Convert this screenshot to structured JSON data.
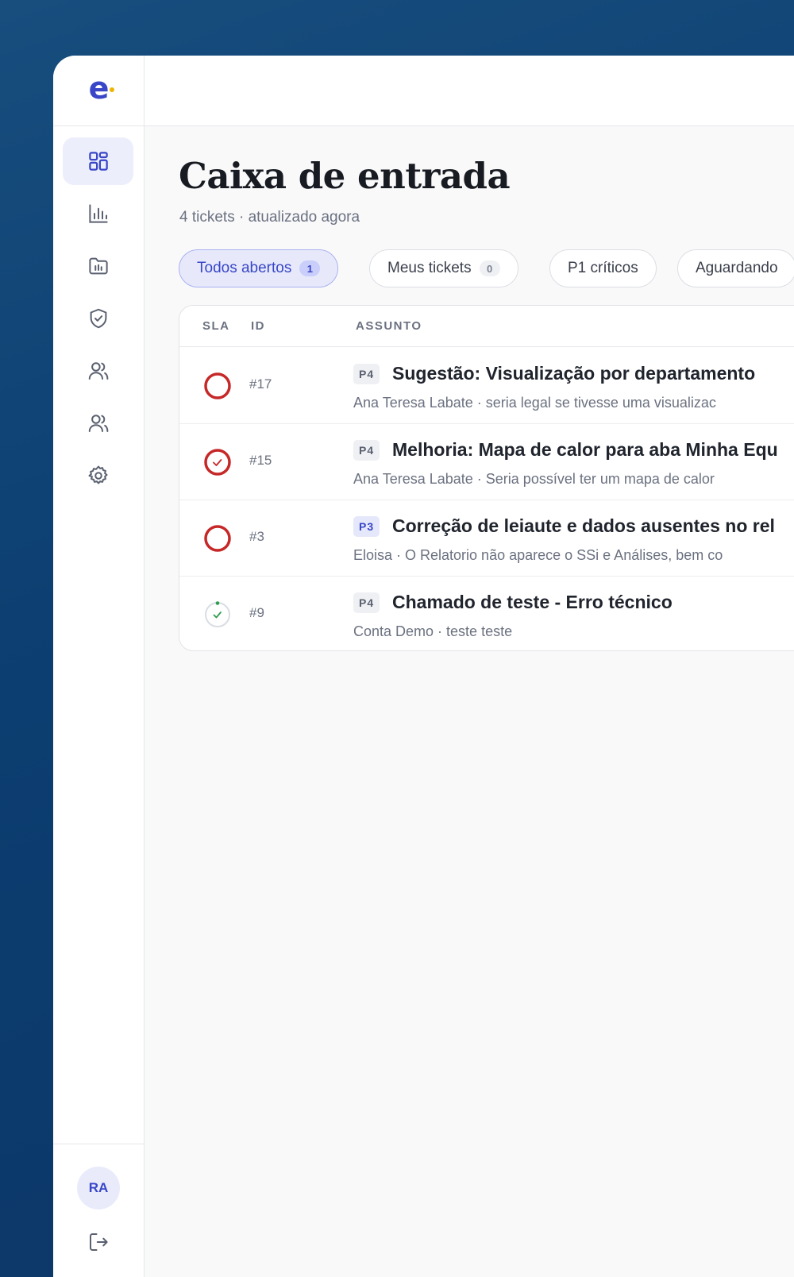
{
  "colors": {
    "brand": "#3846c7",
    "sla_breached": "#c62828",
    "sla_ok": "#2e9e4f",
    "background_gradient": "#0d3f72"
  },
  "sidebar": {
    "logo": "e",
    "nav": [
      {
        "icon": "dashboard-icon",
        "active": true
      },
      {
        "icon": "bar-chart-icon",
        "active": false
      },
      {
        "icon": "folder-chart-icon",
        "active": false
      },
      {
        "icon": "shield-check-icon",
        "active": false
      },
      {
        "icon": "users-icon",
        "active": false
      },
      {
        "icon": "team-icon",
        "active": false
      },
      {
        "icon": "gear-icon",
        "active": false
      }
    ],
    "user_initials": "RA",
    "logout_icon": "logout-icon"
  },
  "page": {
    "title": "Caixa de entrada",
    "subtitle": "4 tickets · atualizado agora"
  },
  "filters": [
    {
      "label": "Todos abertos",
      "count": "1",
      "active": true
    },
    {
      "label": "Meus tickets",
      "count": "0",
      "active": false
    },
    {
      "label": "P1 críticos",
      "count": null,
      "active": false
    },
    {
      "label": "Aguardando",
      "count": null,
      "active": false
    }
  ],
  "table": {
    "columns": {
      "sla": "SLA",
      "id": "ID",
      "subject": "ASSUNTO"
    },
    "rows": [
      {
        "sla_state": "empty",
        "id": "#17",
        "priority": "P4",
        "subject": "Sugestão: Visualização por departamento",
        "preview": "Ana Teresa Labate · seria legal se tivesse uma visualizac"
      },
      {
        "sla_state": "breached-check",
        "id": "#15",
        "priority": "P4",
        "subject": "Melhoria: Mapa de calor para aba Minha Equ",
        "preview": "Ana Teresa Labate · Seria possível ter um mapa de calor"
      },
      {
        "sla_state": "empty",
        "id": "#3",
        "priority": "P3",
        "subject": "Correção de leiaute e dados ausentes no rel",
        "preview": "Eloisa · O Relatorio não aparece o SSi e Análises, bem co"
      },
      {
        "sla_state": "ok-check",
        "id": "#9",
        "priority": "P4",
        "subject": "Chamado de teste - Erro técnico",
        "preview": "Conta Demo · teste teste"
      }
    ]
  }
}
